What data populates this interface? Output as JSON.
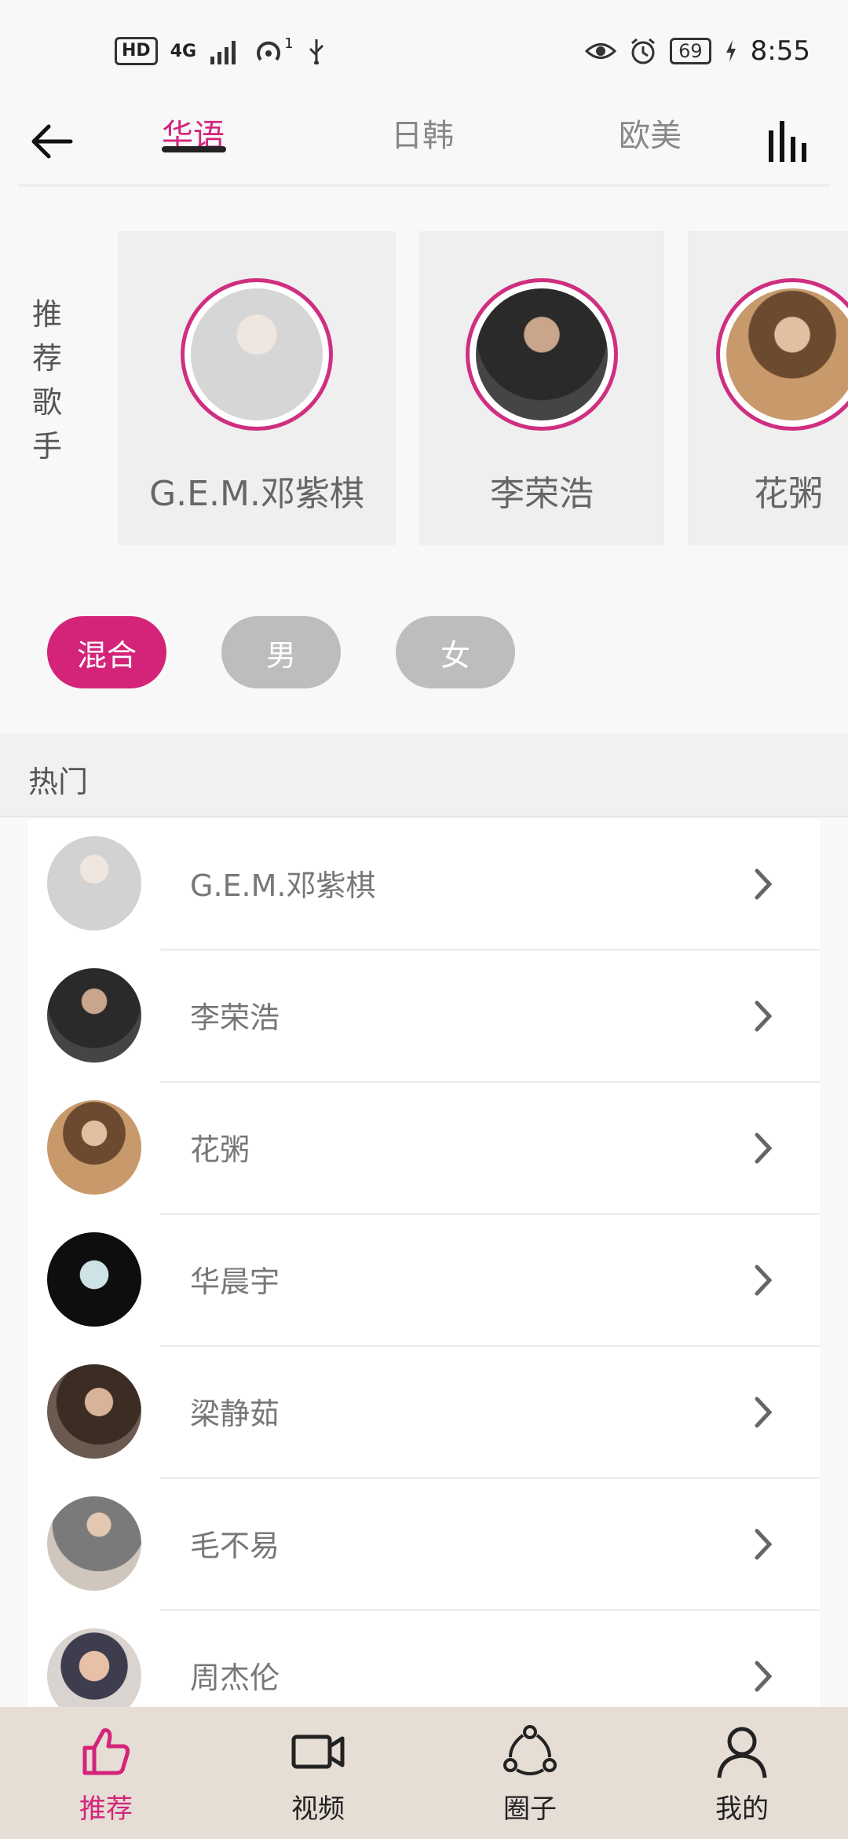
{
  "status_bar": {
    "hd_badge": "HD",
    "network": "4G",
    "sim_slot": "1",
    "battery": "69",
    "time": "8:55"
  },
  "header": {
    "tabs": [
      {
        "label": "华语",
        "active": true
      },
      {
        "label": "日韩",
        "active": false
      },
      {
        "label": "欧美",
        "active": false
      }
    ]
  },
  "recommended": {
    "label_chars": [
      "推",
      "荐",
      "歌",
      "手"
    ],
    "singers": [
      {
        "name": "G.E.M.邓紫棋",
        "avatar_color": "#c9c9c9"
      },
      {
        "name": "李荣浩",
        "avatar_color": "#3a3a3a"
      },
      {
        "name": "花粥",
        "avatar_color": "#b08a66"
      }
    ]
  },
  "filters": [
    {
      "label": "混合",
      "active": true
    },
    {
      "label": "男",
      "active": false
    },
    {
      "label": "女",
      "active": false
    }
  ],
  "hot": {
    "title": "热门",
    "items": [
      {
        "name": "G.E.M.邓紫棋",
        "avatar_color": "#cfcfcf"
      },
      {
        "name": "李荣浩",
        "avatar_color": "#3c3c3c"
      },
      {
        "name": "花粥",
        "avatar_color": "#a87e5a"
      },
      {
        "name": "华晨宇",
        "avatar_color": "#111111"
      },
      {
        "name": "梁静茹",
        "avatar_color": "#5d4b42"
      },
      {
        "name": "毛不易",
        "avatar_color": "#8c8c8c"
      },
      {
        "name": "周杰伦",
        "avatar_color": "#b78e7a"
      }
    ]
  },
  "bottom_nav": [
    {
      "label": "推荐",
      "icon": "thumbs-up-icon",
      "active": true
    },
    {
      "label": "视频",
      "icon": "video-camera-icon",
      "active": false
    },
    {
      "label": "圈子",
      "icon": "share-circle-icon",
      "active": false
    },
    {
      "label": "我的",
      "icon": "user-icon",
      "active": false
    }
  ],
  "colors": {
    "accent": "#d4247a",
    "pill_inactive": "#bdbdbd",
    "nav_bg": "#e6ddd5"
  }
}
